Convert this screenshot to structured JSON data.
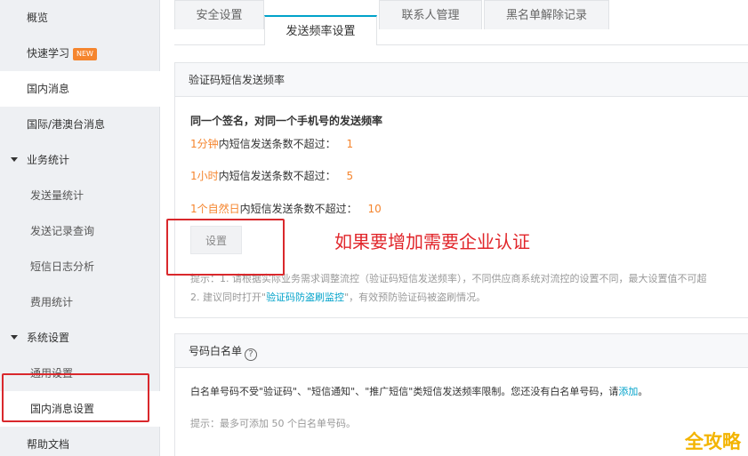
{
  "sidebar": {
    "items": [
      {
        "label": "概览"
      },
      {
        "label": "快速学习",
        "badge": "NEW"
      },
      {
        "label": "国内消息"
      },
      {
        "label": "国际/港澳台消息"
      },
      {
        "label": "业务统计"
      },
      {
        "label": "发送量统计"
      },
      {
        "label": "发送记录查询"
      },
      {
        "label": "短信日志分析"
      },
      {
        "label": "费用统计"
      },
      {
        "label": "系统设置"
      },
      {
        "label": "通用设置"
      },
      {
        "label": "国内消息设置"
      },
      {
        "label": "帮助文档"
      }
    ]
  },
  "tabs": [
    {
      "label": "安全设置"
    },
    {
      "label": "发送频率设置"
    },
    {
      "label": "联系人管理"
    },
    {
      "label": "黑名单解除记录"
    }
  ],
  "frequency": {
    "title": "验证码短信发送频率",
    "heading": "同一个签名，对同一个手机号的发送频率",
    "rules": [
      {
        "unit": "1分钟",
        "text": "内短信发送条数不超过：",
        "value": "1"
      },
      {
        "unit": "1小时",
        "text": "内短信发送条数不超过：",
        "value": "5"
      },
      {
        "unit": "1个自然日",
        "text": "内短信发送条数不超过：",
        "value": "10"
      }
    ],
    "set_button": "设置",
    "tip1": "提示：1. 请根据实际业务需求调整流控（验证码短信发送频率），不同供应商系统对流控的设置不同，最大设置值不可超",
    "tip2_prefix": "2. 建议同时打开\"",
    "tip2_link": "验证码防盗刷监控",
    "tip2_suffix": "\"，有效预防验证码被盗刷情况。"
  },
  "whitelist": {
    "title": "号码白名单",
    "help_icon": "?",
    "desc_prefix": "白名单号码不受\"验证码\"、\"短信通知\"、\"推广短信\"类短信发送频率限制。您还没有白名单号码，请",
    "desc_link": "添加",
    "desc_suffix": "。",
    "tip": "提示：最多可添加 50 个白名单号码。"
  },
  "annotation": "如果要增加需要企业认证",
  "watermark": "全攻略",
  "colors": {
    "accent": "#00a2ca",
    "orange": "#f5852e",
    "annotation_red": "#e1262b"
  }
}
